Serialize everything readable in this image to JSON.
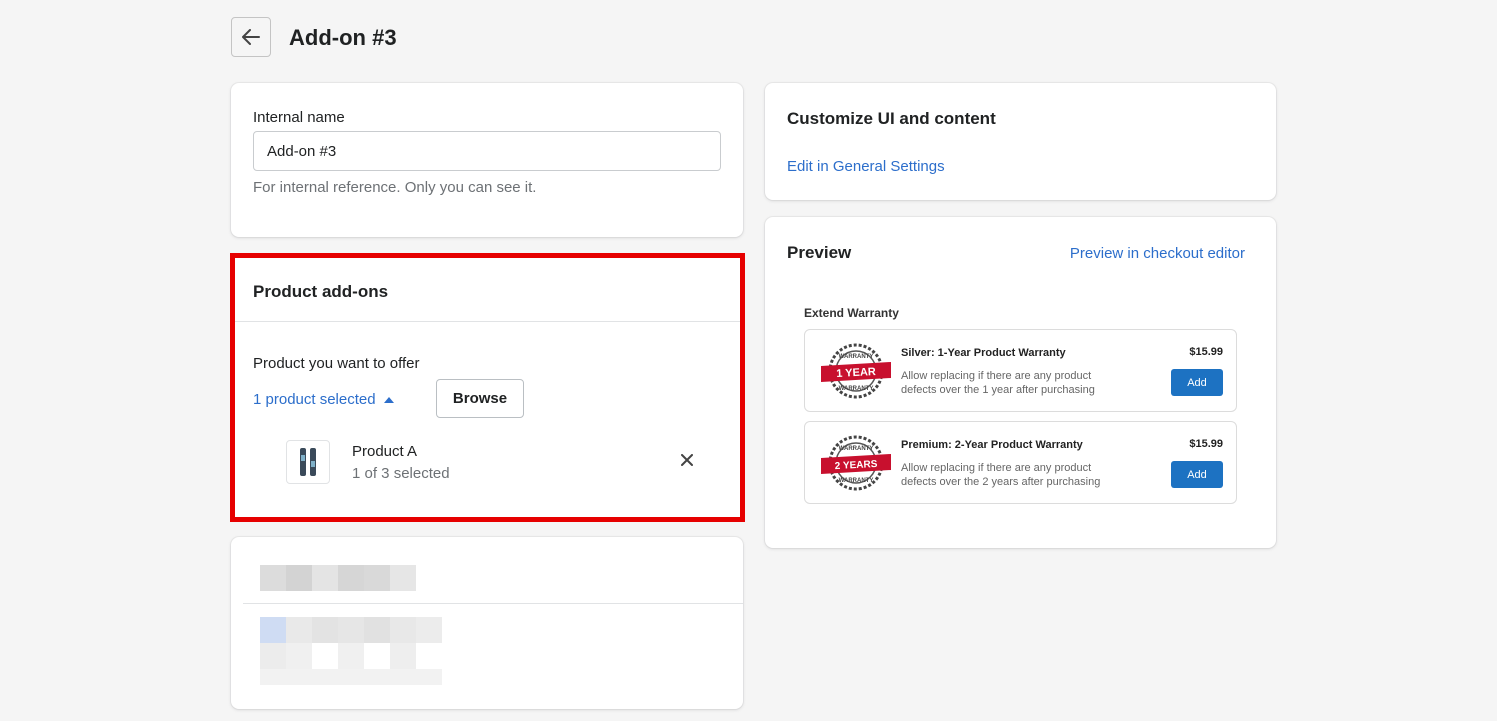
{
  "header": {
    "back_icon": "arrow-left-icon",
    "title": "Add-on #3"
  },
  "internal_name": {
    "label": "Internal name",
    "value": "Add-on #3",
    "help": "For internal reference. Only you can see it."
  },
  "product_addons": {
    "title": "Product add-ons",
    "offer_label": "Product you want to offer",
    "selected_link": "1 product selected",
    "browse_label": "Browse",
    "products": [
      {
        "name": "Product A",
        "variant": "1 of 3 selected",
        "remove_icon": "close-icon"
      }
    ],
    "highlight_color": "#e60000"
  },
  "customize": {
    "title": "Customize UI and content",
    "link": "Edit in General Settings"
  },
  "preview": {
    "title": "Preview",
    "link": "Preview in checkout editor",
    "heading": "Extend Warranty",
    "items": [
      {
        "badge_text": "1 YEAR",
        "badge_ring": "WARRANTY",
        "title": "Silver: 1-Year Product Warranty",
        "desc": "Allow replacing if there are any product defects over the 1 year after purchasing",
        "price": "$15.99",
        "button": "Add"
      },
      {
        "badge_text": "2 YEARS",
        "badge_ring": "WARRANTY",
        "title": "Premium: 2-Year Product Warranty",
        "desc": "Allow replacing if there are any product defects over the 2 years after purchasing",
        "price": "$15.99",
        "button": "Add"
      }
    ],
    "accent_color": "#1d72c2"
  },
  "colors": {
    "link": "#2c6ecb",
    "background": "#f5f5f5"
  }
}
